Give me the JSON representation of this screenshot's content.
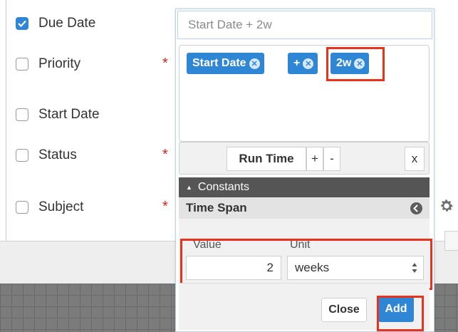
{
  "fields": [
    {
      "label": "Due Date",
      "checked": true,
      "required": false
    },
    {
      "label": "Priority",
      "checked": false,
      "required": true
    },
    {
      "label": "Start Date",
      "checked": false,
      "required": false
    },
    {
      "label": "Status",
      "checked": false,
      "required": true
    },
    {
      "label": "Subject",
      "checked": false,
      "required": true
    }
  ],
  "required_mark": "*",
  "builder": {
    "formula_text": "Start Date + 2w",
    "tokens": [
      "Start Date",
      "+",
      "2w"
    ],
    "token_remove_icon": "x-circle-icon",
    "toolbar": {
      "run_time_label": "Run Time",
      "plus_label": "+",
      "minus_label": "-",
      "clear_label": "x"
    },
    "constants_label": "Constants",
    "time_span_label": "Time Span",
    "value_label": "Value",
    "unit_label": "Unit",
    "value": "2",
    "unit": "weeks",
    "close_label": "Close",
    "add_label": "Add"
  },
  "colors": {
    "accent": "#2f86d4",
    "highlight": "#e8321c",
    "required": "#d21f1f",
    "constants_bar": "#555555"
  }
}
